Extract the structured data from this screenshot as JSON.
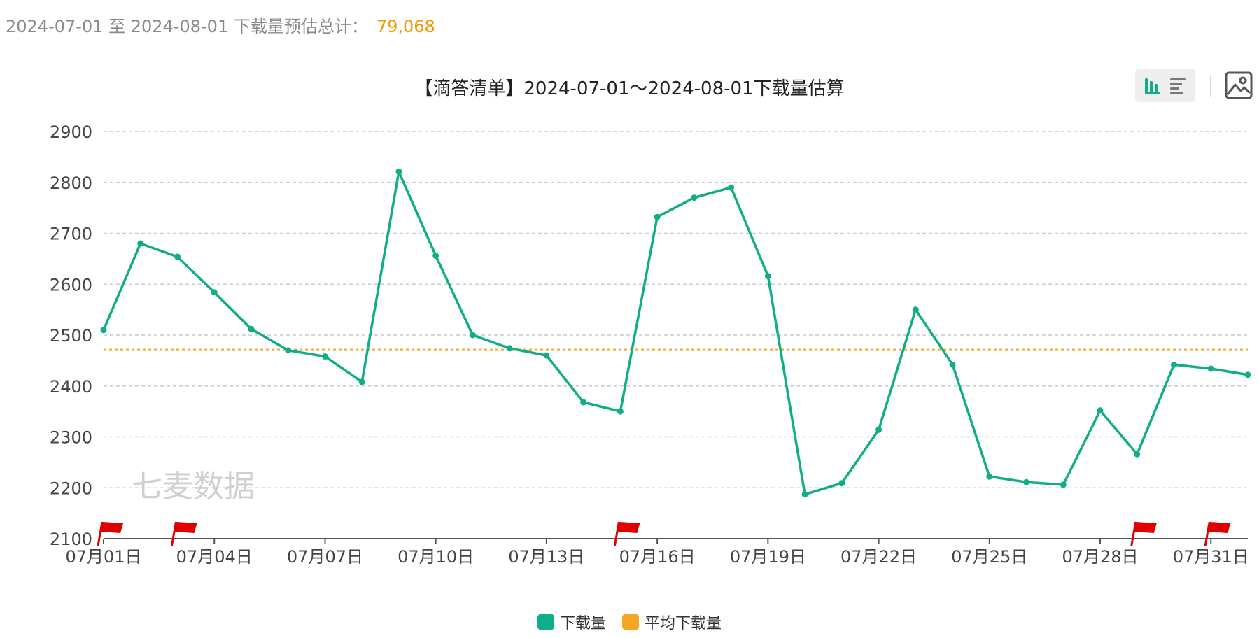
{
  "summary": {
    "range_text": "2024-07-01 至 2024-08-01 下载量预估总计：",
    "total": "79,068"
  },
  "toolbar": {
    "bar_chart_icon": "bar-chart-icon",
    "list_icon": "list-icon",
    "image_icon": "image-icon"
  },
  "watermark": "七麦数据",
  "colors": {
    "series": "#10ae86",
    "average": "#f5a623",
    "total": "#f39800",
    "flag": "#e00000"
  },
  "chart_data": {
    "type": "line",
    "title": "【滴答清单】2024-07-01～2024-08-01下载量估算",
    "xlabel": "",
    "ylabel": "",
    "ylim": [
      2100,
      2900
    ],
    "yticks": [
      2100,
      2200,
      2300,
      2400,
      2500,
      2600,
      2700,
      2800,
      2900
    ],
    "grid": true,
    "legend_position": "bottom",
    "x": [
      "07月01日",
      "07月02日",
      "07月03日",
      "07月04日",
      "07月05日",
      "07月06日",
      "07月07日",
      "07月08日",
      "07月09日",
      "07月10日",
      "07月11日",
      "07月12日",
      "07月13日",
      "07月14日",
      "07月15日",
      "07月16日",
      "07月17日",
      "07月18日",
      "07月19日",
      "07月20日",
      "07月21日",
      "07月22日",
      "07月23日",
      "07月24日",
      "07月25日",
      "07月26日",
      "07月27日",
      "07月28日",
      "07月29日",
      "07月30日",
      "07月31日",
      "08月01日"
    ],
    "x_tick_labels": [
      "07月01日",
      "07月04日",
      "07月07日",
      "07月10日",
      "07月13日",
      "07月16日",
      "07月19日",
      "07月22日",
      "07月25日",
      "07月28日",
      "07月31日"
    ],
    "series": [
      {
        "name": "下载量",
        "values": [
          2510,
          2680,
          2654,
          2584,
          2512,
          2470,
          2458,
          2408,
          2821,
          2656,
          2500,
          2474,
          2460,
          2368,
          2350,
          2732,
          2770,
          2790,
          2616,
          2187,
          2209,
          2314,
          2550,
          2442,
          2222,
          2211,
          2206,
          2352,
          2266,
          2442,
          2434,
          2422
        ]
      },
      {
        "name": "平均下载量",
        "values": [
          2471
        ]
      }
    ],
    "flag_markers": [
      "07月01日",
      "07月03日",
      "07月15日",
      "07月29日",
      "07月31日"
    ]
  }
}
